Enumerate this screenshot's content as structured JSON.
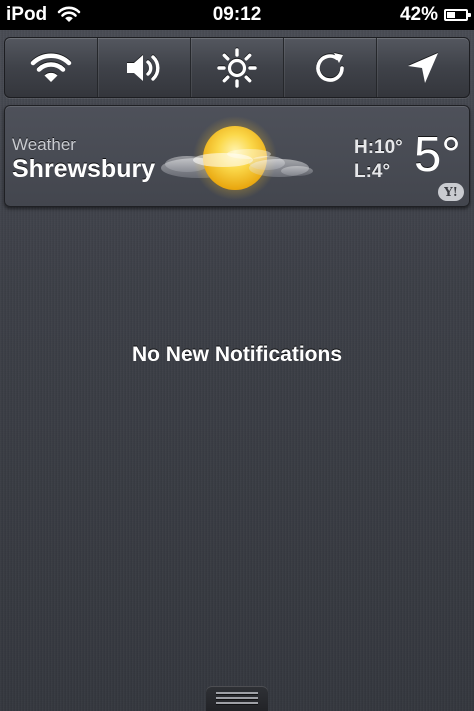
{
  "status_bar": {
    "carrier": "iPod",
    "wifi_icon": "wifi-icon",
    "time": "09:12",
    "battery_percent": "42%",
    "battery_level": 0.42
  },
  "toggles": [
    {
      "name": "wifi-toggle",
      "icon": "wifi-icon"
    },
    {
      "name": "sound-toggle",
      "icon": "speaker-icon"
    },
    {
      "name": "brightness-toggle",
      "icon": "sun-icon"
    },
    {
      "name": "rotation-toggle",
      "icon": "rotation-lock-icon"
    },
    {
      "name": "location-toggle",
      "icon": "location-arrow-icon"
    }
  ],
  "weather": {
    "label": "Weather",
    "city": "Shrewsbury",
    "high": "H:10°",
    "low": "L:4°",
    "temperature": "5°",
    "condition_icon": "sun-behind-clouds-icon",
    "provider_logo": "yahoo-logo",
    "provider_logo_text": "Y!"
  },
  "notifications": {
    "empty_message": "No New Notifications"
  },
  "colors": {
    "background": "#3b3e46",
    "status_bar": "#000000",
    "text": "#ffffff",
    "sun": "#f6c321"
  }
}
